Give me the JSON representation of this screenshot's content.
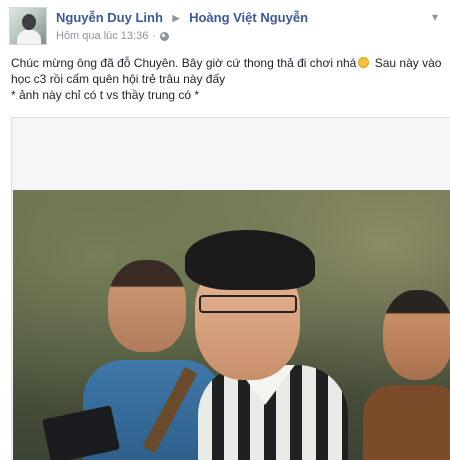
{
  "post": {
    "author": "Nguyễn Duy Linh",
    "recipient": "Hoàng Việt Nguyễn",
    "time": "Hôm qua lúc 13:36",
    "line1": "Chúc mừng ông đã đỗ Chuyên. Bây giờ cứ thong thả đi chơi nhá",
    "line2": "Sau này vào học c3 rồi cấm quên hội trẻ trâu này đấy",
    "line3": "* ảnh này chỉ có t vs thầy trung có *",
    "icons": {
      "arrow": "triangle-right-icon",
      "privacy": "globe-icon",
      "emoji": "smile-emoji-icon",
      "menu": "chevron-down-icon"
    },
    "colors": {
      "name_link": "#3b5998",
      "meta_text": "#90949c",
      "body_text": "#1d2129"
    }
  }
}
